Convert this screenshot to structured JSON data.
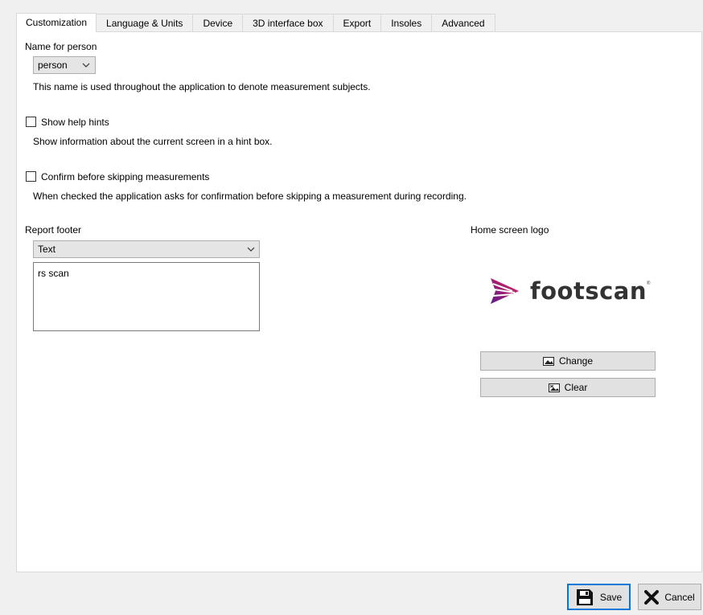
{
  "tabs": [
    {
      "label": "Customization",
      "active": true
    },
    {
      "label": "Language & Units"
    },
    {
      "label": "Device"
    },
    {
      "label": "3D interface box"
    },
    {
      "label": "Export"
    },
    {
      "label": "Insoles"
    },
    {
      "label": "Advanced"
    }
  ],
  "name_section": {
    "label": "Name for person",
    "selected": "person",
    "description": "This name is used throughout the application to denote measurement subjects."
  },
  "help_hints": {
    "label": "Show help hints",
    "checked": false,
    "description": "Show information about the current screen in a hint box."
  },
  "confirm_skip": {
    "label": "Confirm before skipping measurements",
    "checked": false,
    "description": "When checked the application asks for confirmation before skipping a measurement during recording."
  },
  "report_footer": {
    "label": "Report footer",
    "type_selected": "Text",
    "text_value": "rs scan"
  },
  "logo_section": {
    "label": "Home screen logo",
    "logo_text": "footscan",
    "change_label": "Change",
    "clear_label": "Clear"
  },
  "buttons": {
    "save": "Save",
    "cancel": "Cancel"
  },
  "colors": {
    "accent": "#0078d7",
    "logo_purple": "#6a1b8f",
    "logo_red": "#e0245e"
  }
}
